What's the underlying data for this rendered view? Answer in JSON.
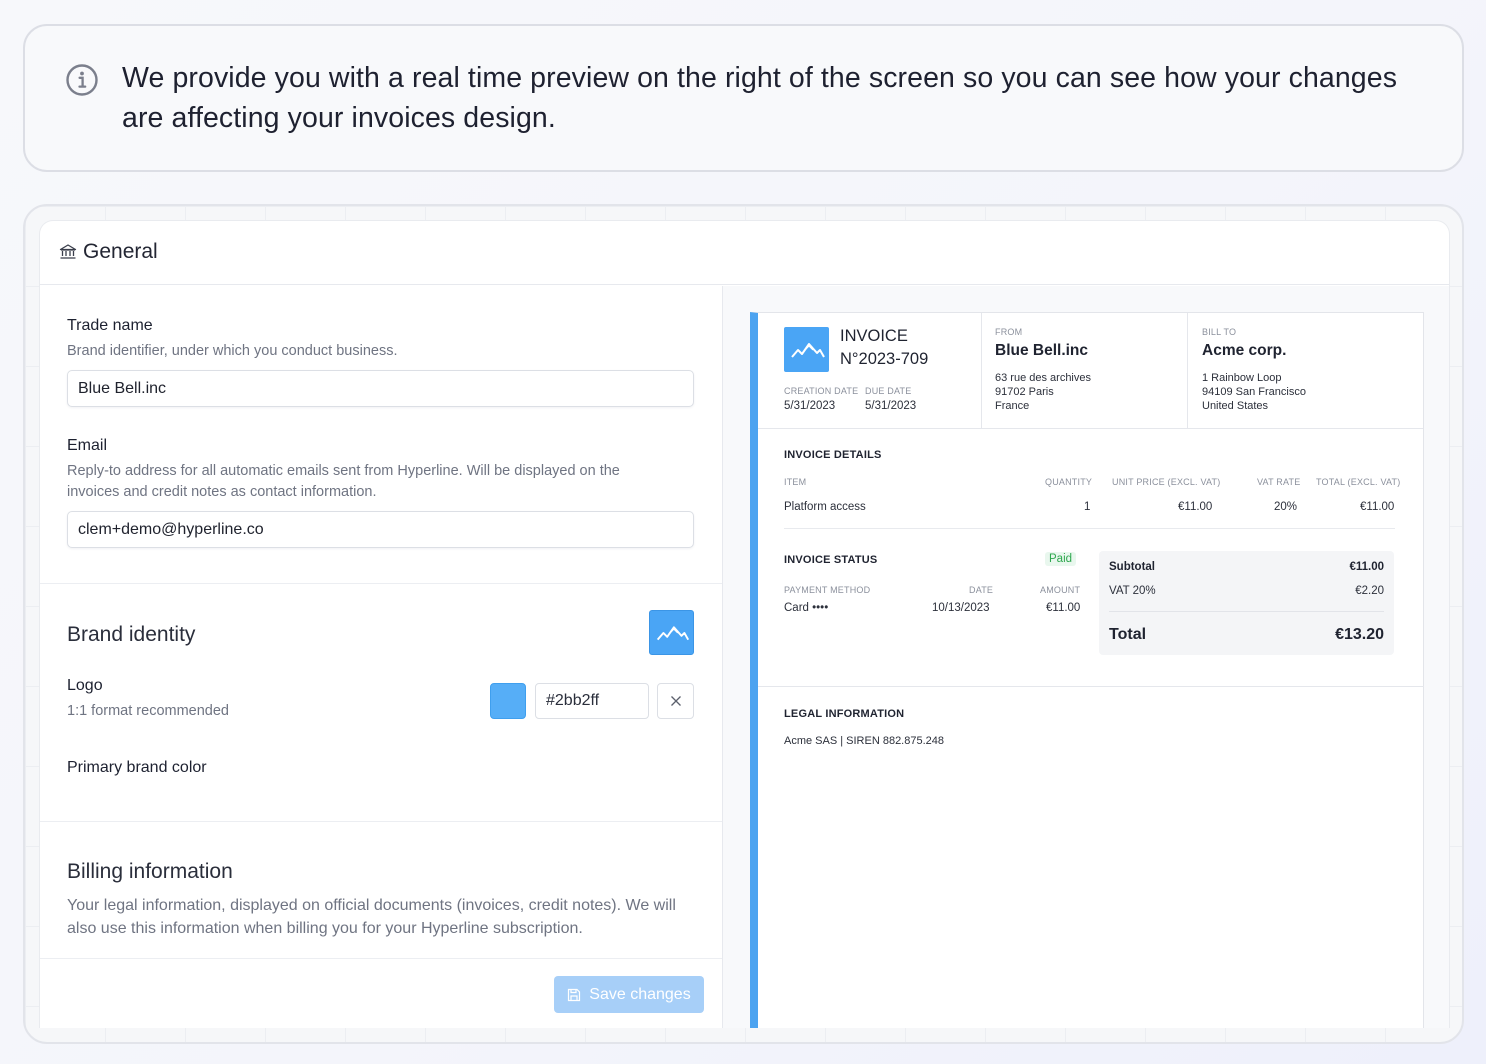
{
  "banner": {
    "message": "We provide you with a real time preview on the right of the screen so you can see how your changes are affecting your invoices design."
  },
  "header": {
    "title": "General"
  },
  "form": {
    "trade_name": {
      "label": "Trade name",
      "hint": "Brand identifier, under which you conduct business.",
      "value": "Blue Bell.inc"
    },
    "email": {
      "label": "Email",
      "hint": "Reply-to address for all automatic emails sent from Hyperline. Will be displayed on the invoices and credit notes as contact information.",
      "value": "clem+demo@hyperline.co"
    },
    "brand_identity": {
      "title": "Brand identity",
      "logo_label": "Logo",
      "logo_hint": "1:1 format recommended",
      "color_label": "Primary brand color",
      "color_value": "#2bb2ff"
    },
    "billing": {
      "title": "Billing information",
      "hint": "Your legal information, displayed on official documents (invoices, credit notes). We will also use this information when billing you for your Hyperline subscription."
    },
    "save_label": "Save changes"
  },
  "invoice": {
    "title": "INVOICE",
    "number": "N°2023-709",
    "creation_date_label": "CREATION DATE",
    "creation_date": "5/31/2023",
    "due_date_label": "DUE DATE",
    "due_date": "5/31/2023",
    "from_label": "FROM",
    "from_name": "Blue Bell.inc",
    "from_address": [
      "63 rue des archives",
      "91702 Paris",
      "France"
    ],
    "bill_to_label": "BILL TO",
    "bill_to_name": "Acme corp.",
    "bill_to_address": [
      "1 Rainbow Loop",
      "94109 San Francisco",
      "United States"
    ],
    "details_title": "INVOICE DETAILS",
    "columns": [
      "ITEM",
      "QUANTITY",
      "UNIT PRICE (EXCL. VAT)",
      "VAT RATE",
      "TOTAL (EXCL. VAT)"
    ],
    "items": [
      {
        "item": "Platform access",
        "quantity": "1",
        "unit_price": "€11.00",
        "vat_rate": "20%",
        "total": "€11.00"
      }
    ],
    "status_title": "INVOICE STATUS",
    "status": "Paid",
    "payment_columns": [
      "PAYMENT METHOD",
      "DATE",
      "AMOUNT"
    ],
    "payment": {
      "method": "Card ••••",
      "date": "10/13/2023",
      "amount": "€11.00"
    },
    "subtotal_label": "Subtotal",
    "subtotal": "€11.00",
    "vat_label": "VAT 20%",
    "vat": "€2.20",
    "total_label": "Total",
    "total": "€13.20",
    "legal_title": "LEGAL INFORMATION",
    "legal_text": "Acme SAS | SIREN 882.875.248"
  },
  "colors": {
    "accent": "#4ca3f0",
    "paid": "#2fa84f"
  }
}
